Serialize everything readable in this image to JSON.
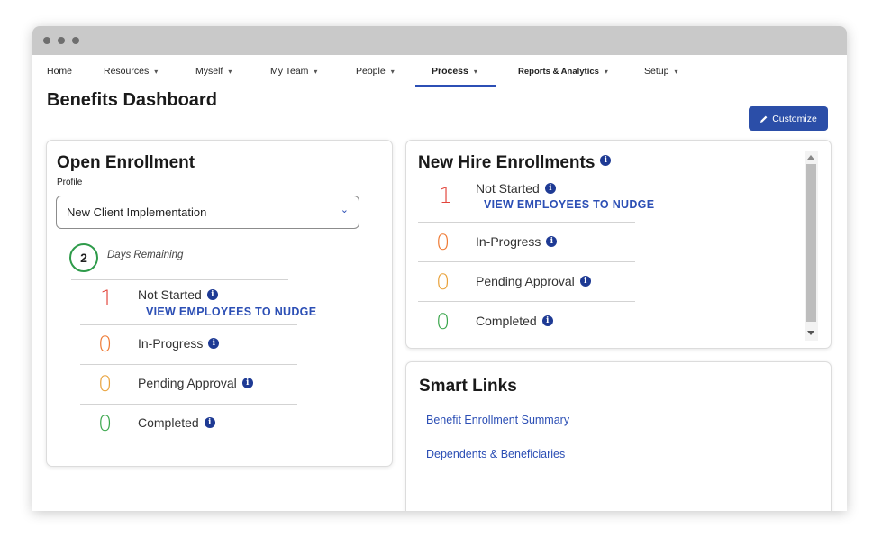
{
  "nav": {
    "items": [
      {
        "label": "Home",
        "caret": false
      },
      {
        "label": "Resources",
        "caret": true
      },
      {
        "label": "Myself",
        "caret": true
      },
      {
        "label": "My Team",
        "caret": true
      },
      {
        "label": "People",
        "caret": true
      },
      {
        "label": "Process",
        "caret": true,
        "active": true
      },
      {
        "label": "Reports & Analytics",
        "caret": true
      },
      {
        "label": "Setup",
        "caret": true
      }
    ],
    "caret_glyph": "▾"
  },
  "page": {
    "title": "Benefits Dashboard",
    "customize_label": "Customize"
  },
  "open_enrollment": {
    "title": "Open Enrollment",
    "profile_label": "Profile",
    "profile_value": "New Client Implementation",
    "days_remaining_value": "2",
    "days_remaining_label": "Days Remaining",
    "statuses": [
      {
        "count": "1",
        "label": "Not Started",
        "color": "#e2453c"
      },
      {
        "count": "0",
        "label": "In-Progress",
        "color": "#ef7a34"
      },
      {
        "count": "0",
        "label": "Pending Approval",
        "color": "#e9a23b"
      },
      {
        "count": "0",
        "label": "Completed",
        "color": "#3aa64c"
      }
    ],
    "nudge_link": "VIEW EMPLOYEES TO NUDGE"
  },
  "new_hire": {
    "title": "New Hire Enrollments",
    "statuses": [
      {
        "count": "1",
        "label": "Not Started",
        "color": "#e2453c"
      },
      {
        "count": "0",
        "label": "In-Progress",
        "color": "#ef7a34"
      },
      {
        "count": "0",
        "label": "Pending Approval",
        "color": "#e9a23b"
      },
      {
        "count": "0",
        "label": "Completed",
        "color": "#3aa64c"
      }
    ],
    "nudge_link": "VIEW EMPLOYEES TO NUDGE"
  },
  "smart_links": {
    "title": "Smart Links",
    "links": [
      "Benefit Enrollment Summary",
      "Dependents & Beneficiaries"
    ]
  },
  "colors": {
    "accent": "#2c4fb5",
    "button": "#2b4ea8",
    "info_icon": "#1e3a94"
  }
}
